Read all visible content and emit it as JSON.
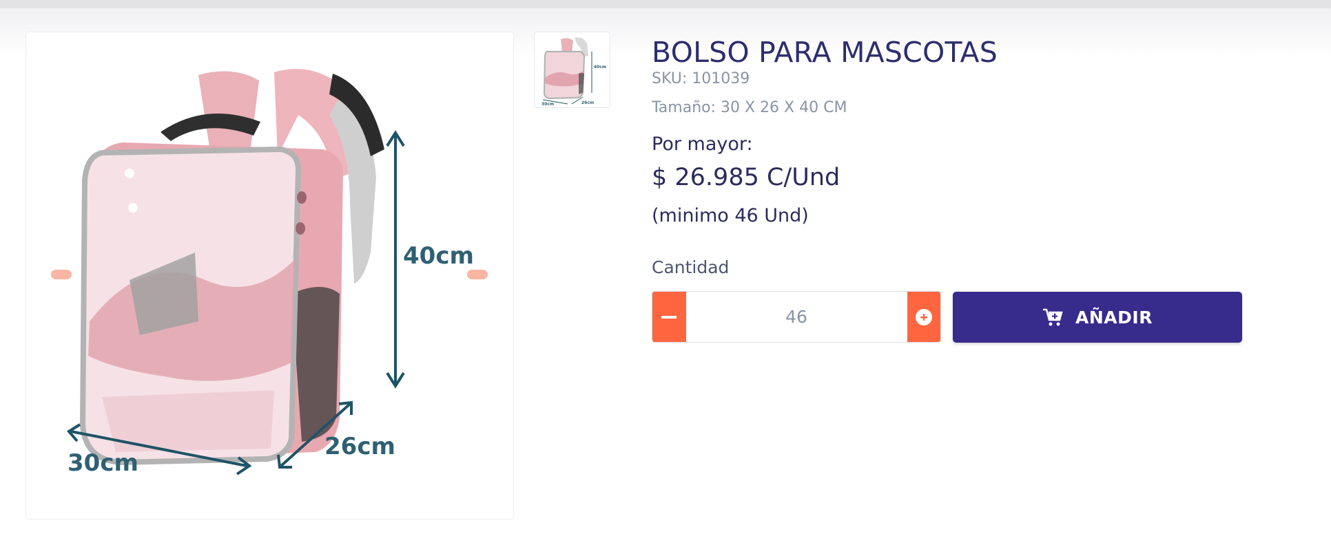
{
  "product": {
    "title": "BOLSO PARA MASCOTAS",
    "sku": "SKU: 101039",
    "size": "Tamaño: 30 X 26 X 40 CM",
    "wholesale_label": "Por mayor:",
    "price": "$ 26.985 C/Und",
    "minimum": "(minimo 46 Und)"
  },
  "image": {
    "dimension_height": "40cm",
    "dimension_width": "30cm",
    "dimension_depth": "26cm"
  },
  "thumbnail": {
    "dimension_height": "40cm",
    "dimension_width": "30cm",
    "dimension_depth": "26cm"
  },
  "quantity": {
    "label": "Cantidad",
    "value": "46"
  },
  "add_to_cart": {
    "label": "AÑADIR",
    "icon": "cart-plus-icon"
  },
  "colors": {
    "accent": "#ff6640",
    "primary": "#372b8c",
    "text_dark": "#2d2d6e",
    "text_muted": "#8a93a5",
    "carousel_dot": "#fcb5a2"
  }
}
